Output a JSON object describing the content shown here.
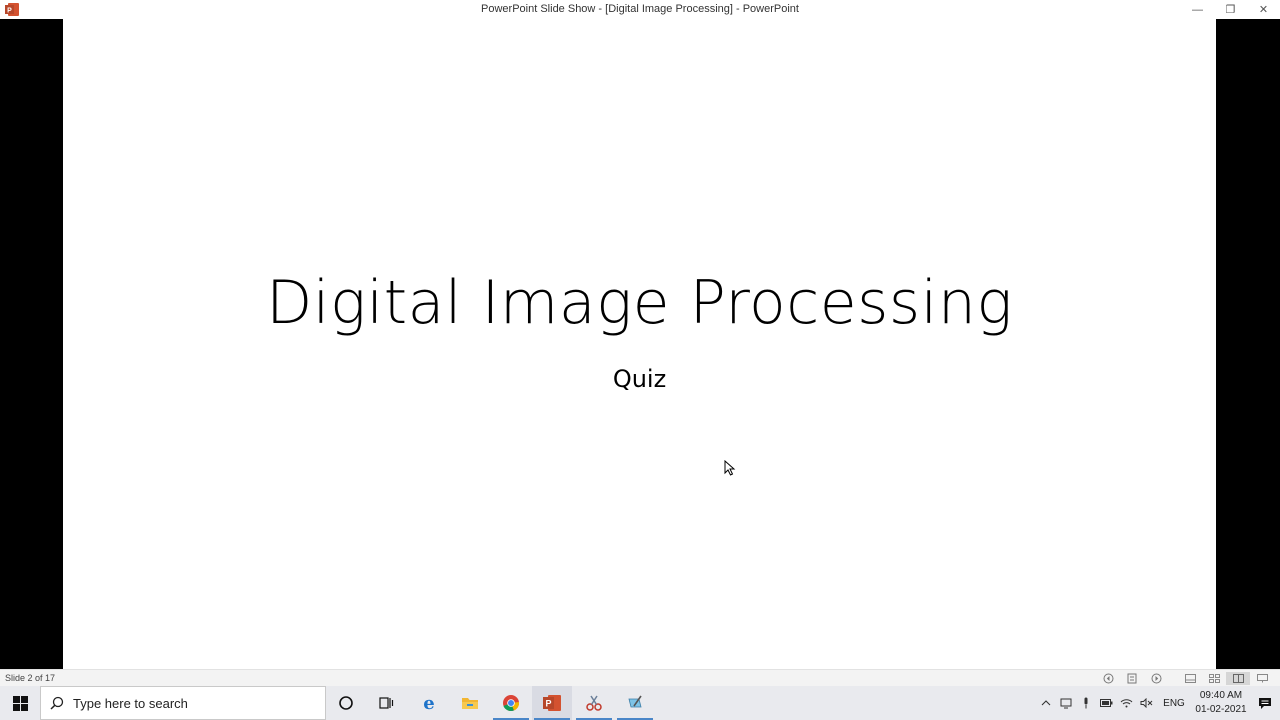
{
  "window": {
    "title": "PowerPoint Slide Show - [Digital Image Processing] - PowerPoint",
    "minimize_glyph": "—",
    "restore_glyph": "❐",
    "close_glyph": "✕"
  },
  "slide": {
    "title": "Digital Image Processing",
    "subtitle": "Quiz"
  },
  "statusbar": {
    "slide_counter": "Slide 2 of 17",
    "icons": [
      "previous-icon",
      "slide-menu-icon",
      "next-icon",
      "normal-view-icon",
      "slide-sorter-icon",
      "reading-view-icon",
      "slideshow-icon"
    ]
  },
  "taskbar": {
    "search_placeholder": "Type here to search",
    "apps": [
      "cortana-icon",
      "task-view-icon",
      "edge-icon",
      "file-explorer-icon",
      "chrome-icon",
      "powerpoint-icon",
      "snipping-tool-icon",
      "notepad-icon"
    ],
    "language": "ENG",
    "time": "09:40 AM",
    "date": "01-02-2021"
  },
  "colors": {
    "powerpoint": "#c43e1c",
    "edge": "#1e73c9",
    "folder": "#f2b632",
    "accent": "#4a86c8"
  }
}
